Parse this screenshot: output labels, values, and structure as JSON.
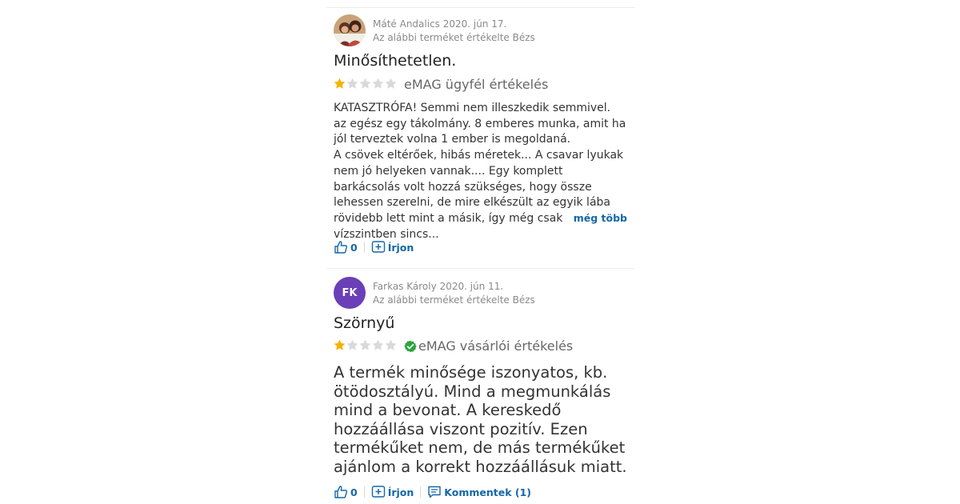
{
  "reviews": [
    {
      "author": "Máté Andalics",
      "date": "2020. jún 17.",
      "product_note": "Az alábbi terméket értékelte Bézs",
      "title": "Minősíthetetlen.",
      "rating": 1,
      "rating_max": 5,
      "badge": "eMAG ügyfél értékelés",
      "verified": false,
      "body_lines": [
        "KATASZTRÓFA! Semmi nem illeszkedik semmivel.",
        "az egész egy tákolmány. 8 emberes munka, amit ha jól terveztek volna 1 ember is megoldaná.",
        "A csövek eltérőek, hibás méretek... A csavar lyukak nem jó helyeken vannak.... Egy komplett barkácsolás volt hozzá szükséges, hogy össze lehessen szerelni, de mire elkészült az egyik lába rövidebb lett mint a másik, így még csak vízszintben sincs..."
      ],
      "more_label": "még több",
      "likes": "0",
      "reply_label": "Írjon"
    },
    {
      "author": "Farkas Károly",
      "date": "2020. jún 11.",
      "initials": "FK",
      "product_note": "Az alábbi terméket értékelte Bézs",
      "title": "Szörnyű",
      "rating": 1,
      "rating_max": 5,
      "badge": "eMAG vásárlói értékelés",
      "verified": true,
      "body": "A termék minősége iszonyatos, kb. ötödosztályú. Mind a megmunkálás mind a bevonat. A kereskedő hozzáállása viszont pozitív. Ezen termékűket nem, de más termékűket ajánlom a korrekt hozzáállásuk miatt.",
      "likes": "0",
      "reply_label": "Írjon",
      "comments_label": "Kommentek (1)"
    }
  ],
  "colors": {
    "star_filled": "#f5b301",
    "star_empty": "#d9d9d9",
    "link": "#1667a6",
    "verified": "#2aa43c",
    "avatar_bg": "#6a3fb8"
  }
}
